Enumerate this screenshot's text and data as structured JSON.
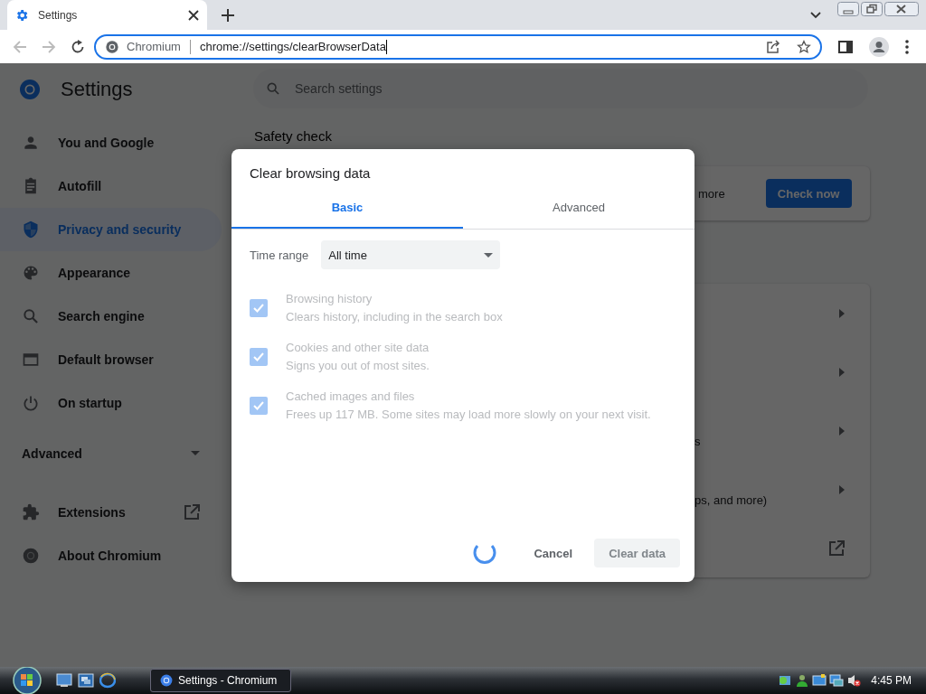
{
  "browser": {
    "tabs": [
      {
        "title": "Settings",
        "selected": true
      }
    ],
    "address": {
      "site_label": "Chromium",
      "url": "chrome://settings/clearBrowserData"
    }
  },
  "settings": {
    "title": "Settings",
    "search": {
      "placeholder": "Search settings"
    },
    "sidebar": {
      "items": [
        {
          "label": "You and Google",
          "selected": false
        },
        {
          "label": "Autofill",
          "selected": false
        },
        {
          "label": "Privacy and security",
          "selected": true
        },
        {
          "label": "Appearance",
          "selected": false
        },
        {
          "label": "Search engine",
          "selected": false
        },
        {
          "label": "Default browser",
          "selected": false
        },
        {
          "label": "On startup",
          "selected": false
        }
      ],
      "advanced": {
        "label": "Advanced",
        "expanded": false
      },
      "bottom_items": [
        {
          "label": "Extensions",
          "external": true
        },
        {
          "label": "About Chromium",
          "external": false
        }
      ]
    },
    "main": {
      "heading": "Safety check",
      "safety_card": {
        "text": "more",
        "button": "Check now"
      },
      "rows": [
        {
          "kind": "arrow"
        },
        {
          "kind": "arrow"
        },
        {
          "kind": "arrow",
          "fragment": "s"
        },
        {
          "kind": "arrow",
          "fragment": "ps, and more)"
        },
        {
          "kind": "external"
        }
      ]
    }
  },
  "dialog": {
    "title": "Clear browsing data",
    "tabs": [
      {
        "label": "Basic",
        "selected": true
      },
      {
        "label": "Advanced",
        "selected": false
      }
    ],
    "time_range": {
      "label": "Time range",
      "value": "All time"
    },
    "options": [
      {
        "label": "Browsing history",
        "description": "Clears history, including in the search box",
        "checked": true,
        "disabled": true
      },
      {
        "label": "Cookies and other site data",
        "description": "Signs you out of most sites.",
        "checked": true,
        "disabled": true
      },
      {
        "label": "Cached images and files",
        "description": "Frees up 117 MB. Some sites may load more slowly on your next visit.",
        "checked": true,
        "disabled": true
      }
    ],
    "busy": true,
    "buttons": [
      {
        "label": "Cancel",
        "kind": "text",
        "disabled": false
      },
      {
        "label": "Clear data",
        "kind": "action",
        "disabled": true
      }
    ]
  },
  "taskbar": {
    "window_button": "Settings - Chromium",
    "clock": "4:45 PM"
  }
}
